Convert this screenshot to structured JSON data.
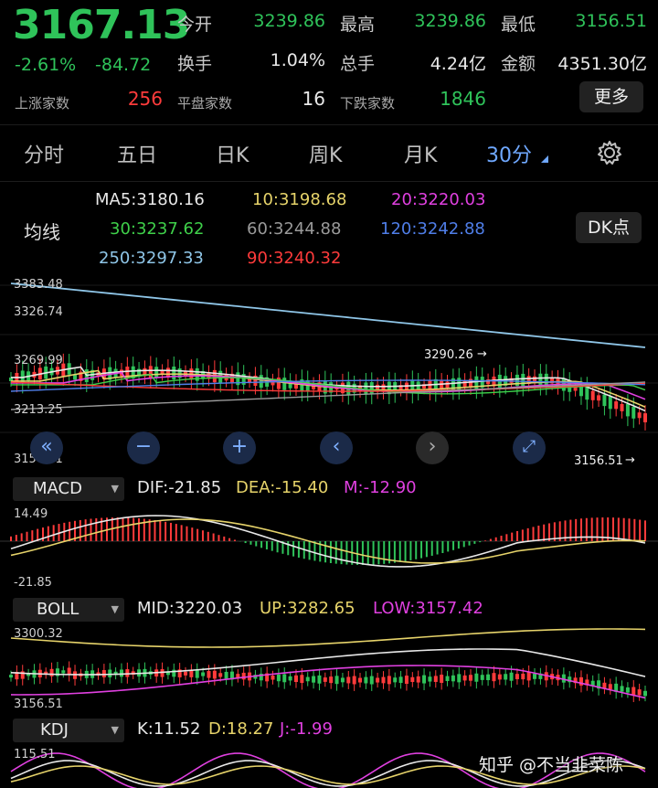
{
  "quote": {
    "price": "3167.13",
    "change_pct": "-2.61%",
    "change": "-84.72",
    "open_label": "今开",
    "open": "3239.86",
    "high_label": "最高",
    "high": "3239.86",
    "low_label": "最低",
    "low": "3156.51",
    "turnover_label": "换手",
    "turnover": "1.04%",
    "volume_label": "总手",
    "volume": "4.24亿",
    "amount_label": "金额",
    "amount": "4351.30亿",
    "up_label": "上涨家数",
    "up": "256",
    "flat_label": "平盘家数",
    "flat": "16",
    "down_label": "下跌家数",
    "down": "1846",
    "more_label": "更多"
  },
  "tabs": [
    "分时",
    "五日",
    "日K",
    "周K",
    "月K",
    "30分"
  ],
  "active_tab": "30分",
  "ma": {
    "label": "均线",
    "dk_label": "DK点",
    "items": [
      {
        "text": "MA5:3180.16",
        "color": "#e8e8e8"
      },
      {
        "text": "10:3198.68",
        "color": "#e6d36a"
      },
      {
        "text": "20:3220.03",
        "color": "#e040e0"
      },
      {
        "text": "30:3237.62",
        "color": "#3fd04a"
      },
      {
        "text": "60:3244.88",
        "color": "#9a9a9a"
      },
      {
        "text": "120:3242.88",
        "color": "#4f7ee8"
      },
      {
        "text": "250:3297.33",
        "color": "#8fc6e8"
      },
      {
        "text": "90:3240.32",
        "color": "#ff3b3b"
      }
    ]
  },
  "main_chart": {
    "axis": [
      "3383.48",
      "3326.74",
      "3269.99",
      "3213.25",
      "3156.51"
    ],
    "high_mark": "3290.26",
    "low_mark": "3156.51"
  },
  "macd": {
    "selector": "MACD",
    "dif": "DIF:-21.85",
    "dea": "DEA:-15.40",
    "m": "M:-12.90",
    "axis_top": "14.49",
    "axis_bottom": "-21.85"
  },
  "boll": {
    "selector": "BOLL",
    "mid": "MID:3220.03",
    "up": "UP:3282.65",
    "low": "LOW:3157.42",
    "axis_top": "3300.32",
    "axis_bottom": "3156.51"
  },
  "kdj": {
    "selector": "KDJ",
    "k": "K:11.52",
    "d": "D:18.27",
    "j": "J:-1.99",
    "axis_top": "115.51"
  },
  "watermark": "知乎 @不当韭菜陈",
  "colors": {
    "up": "#ff3b3b",
    "down": "#2fc35a",
    "accent": "#6fa8ff"
  }
}
